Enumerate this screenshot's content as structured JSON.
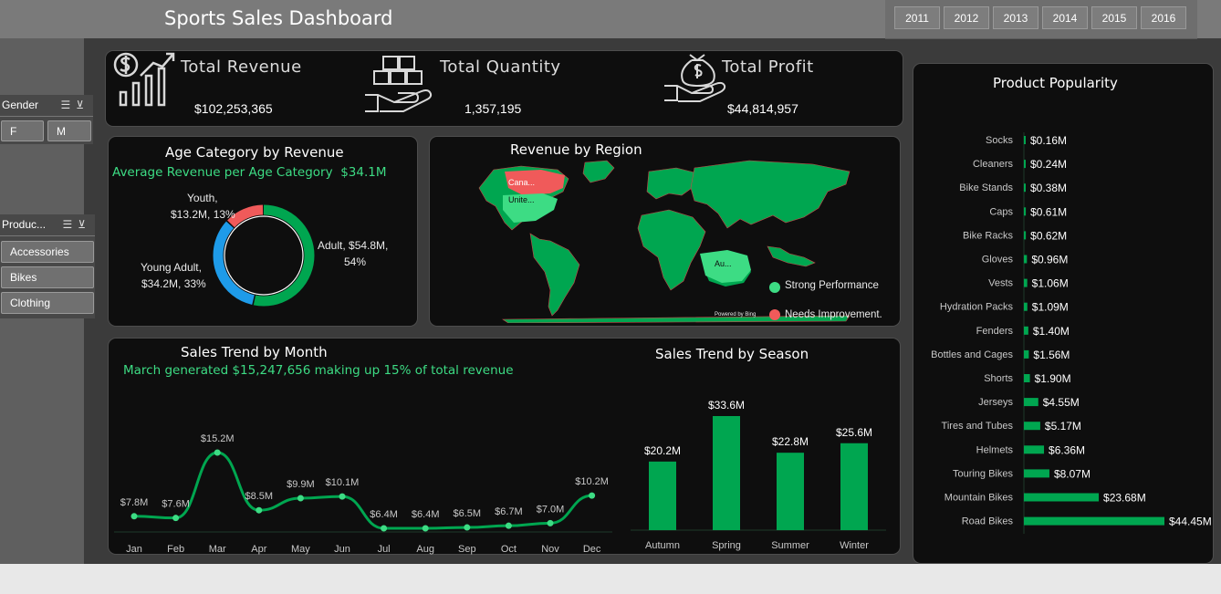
{
  "header": {
    "title": "Sports Sales Dashboard"
  },
  "years": [
    "2011",
    "2012",
    "2013",
    "2014",
    "2015",
    "2016"
  ],
  "gender_slicer": {
    "title": "Gender",
    "items": [
      "F",
      "M"
    ]
  },
  "product_slicer": {
    "title": "Produc...",
    "items": [
      "Accessories",
      "Bikes",
      "Clothing"
    ]
  },
  "kpis": {
    "revenue": {
      "label": "Total  Revenue",
      "value": "$102,253,365"
    },
    "quantity": {
      "label": "Total  Quantity",
      "value": "1,357,195"
    },
    "profit": {
      "label": "Total  Profit",
      "value": "$44,814,957"
    }
  },
  "age": {
    "title": "Age Category by Revenue",
    "subtitle": "Average Revenue per Age Category",
    "subtitle_value": "$34.1M",
    "label_youth_1": "Youth,",
    "label_youth_2": "$13.2M, 13%",
    "label_adult_1": "Adult, $54.8M,",
    "label_adult_2": "54%",
    "label_young_1": "Young Adult,",
    "label_young_2": "$34.2M, 33%"
  },
  "region": {
    "title": "Revenue by Region",
    "label_canada": "Cana...",
    "label_us": "Unite...",
    "label_au": "Au...",
    "legend_strong": "Strong Performance",
    "legend_needs": "Needs Improvement.",
    "powered": "Powered by Bing"
  },
  "month": {
    "title": "Sales Trend by Month",
    "subtitle": "March generated $15,247,656 making up 15% of total revenue"
  },
  "season": {
    "title": "Sales Trend by Season"
  },
  "popularity": {
    "title": "Product Popularity"
  },
  "colors": {
    "green": "#00a650",
    "red": "#f05a5a",
    "blue": "#1e9be9",
    "accent_text": "#3ddc84"
  },
  "chart_data": [
    {
      "type": "pie",
      "title": "Age Category by Revenue",
      "categories": [
        "Adult",
        "Young Adult",
        "Youth"
      ],
      "values": [
        54.8,
        34.2,
        13.2
      ],
      "percents": [
        54,
        33,
        13
      ],
      "colors": [
        "#00a650",
        "#1e9be9",
        "#f05a5a"
      ]
    },
    {
      "type": "line",
      "title": "Sales Trend by Month",
      "categories": [
        "Jan",
        "Feb",
        "Mar",
        "Apr",
        "May",
        "Jun",
        "Jul",
        "Aug",
        "Sep",
        "Oct",
        "Nov",
        "Dec"
      ],
      "values": [
        7.8,
        7.6,
        15.2,
        8.5,
        9.9,
        10.1,
        6.4,
        6.4,
        6.5,
        6.7,
        7.0,
        10.2
      ],
      "data_labels": [
        "$7.8M",
        "$7.6M",
        "$15.2M",
        "$8.5M",
        "$9.9M",
        "$10.1M",
        "$6.4M",
        "$6.4M",
        "$6.5M",
        "$6.7M",
        "$7.0M",
        "$10.2M"
      ]
    },
    {
      "type": "bar",
      "title": "Sales Trend by Season",
      "categories": [
        "Autumn",
        "Spring",
        "Summer",
        "Winter"
      ],
      "values": [
        20.2,
        33.6,
        22.8,
        25.6
      ],
      "data_labels": [
        "$20.2M",
        "$33.6M",
        "$22.8M",
        "$25.6M"
      ]
    },
    {
      "type": "bar",
      "title": "Product Popularity",
      "orientation": "horizontal",
      "categories": [
        "Socks",
        "Cleaners",
        "Bike Stands",
        "Caps",
        "Bike Racks",
        "Gloves",
        "Vests",
        "Hydration Packs",
        "Fenders",
        "Bottles and Cages",
        "Shorts",
        "Jerseys",
        "Tires and Tubes",
        "Helmets",
        "Touring Bikes",
        "Mountain Bikes",
        "Road Bikes"
      ],
      "values": [
        0.16,
        0.24,
        0.38,
        0.61,
        0.62,
        0.96,
        1.06,
        1.09,
        1.4,
        1.56,
        1.9,
        4.55,
        5.17,
        6.36,
        8.07,
        23.68,
        44.45
      ],
      "data_labels": [
        "$0.16M",
        "$0.24M",
        "$0.38M",
        "$0.61M",
        "$0.62M",
        "$0.96M",
        "$1.06M",
        "$1.09M",
        "$1.40M",
        "$1.56M",
        "$1.90M",
        "$4.55M",
        "$5.17M",
        "$6.36M",
        "$8.07M",
        "$23.68M",
        "$44.45M"
      ]
    }
  ]
}
